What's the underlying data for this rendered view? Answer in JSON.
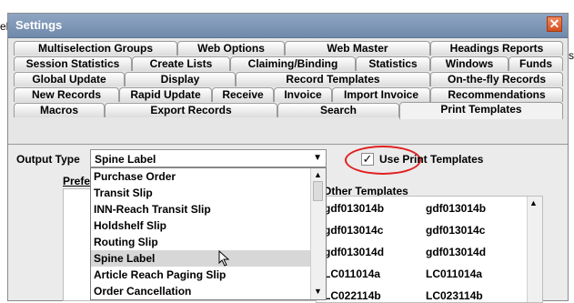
{
  "title": "Settings",
  "background_fragments": {
    "left": "el",
    "right": "s"
  },
  "tabs": {
    "row1": [
      "Multiselection Groups",
      "Web Options",
      "Web Master",
      "Headings Reports"
    ],
    "row2": [
      "Session Statistics",
      "Create Lists",
      "Claiming/Binding",
      "Statistics",
      "Windows",
      "Funds"
    ],
    "row3": [
      "Global Update",
      "Display",
      "Record Templates",
      "On-the-fly Records"
    ],
    "row4": [
      "New Records",
      "Rapid Update",
      "Receive",
      "Invoice",
      "Import Invoice",
      "Recommendations"
    ],
    "row5": [
      "Macros",
      "Export Records",
      "Search",
      "Print Templates"
    ],
    "active": "Print Templates"
  },
  "output_type": {
    "label": "Output Type",
    "value": "Spine Label"
  },
  "use_print_templates": {
    "label": "Use Print Templates",
    "checked": true
  },
  "preferred_header": "Prefer",
  "other_templates": {
    "title": "Other Templates",
    "rows": [
      [
        "gdf013014b",
        "gdf013014b"
      ],
      [
        "gdf013014c",
        "gdf013014c"
      ],
      [
        "gdf013014d",
        "gdf013014d"
      ],
      [
        "LC011014a",
        "LC011014a"
      ],
      [
        "LC022114b",
        "LC023114b"
      ]
    ]
  },
  "dropdown_options": [
    "Purchase Order",
    "Transit Slip",
    "INN-Reach Transit Slip",
    "Holdshelf Slip",
    "Routing Slip",
    "Spine Label",
    "Article Reach Paging Slip",
    "Order Cancellation"
  ],
  "dropdown_selected": "Spine Label"
}
